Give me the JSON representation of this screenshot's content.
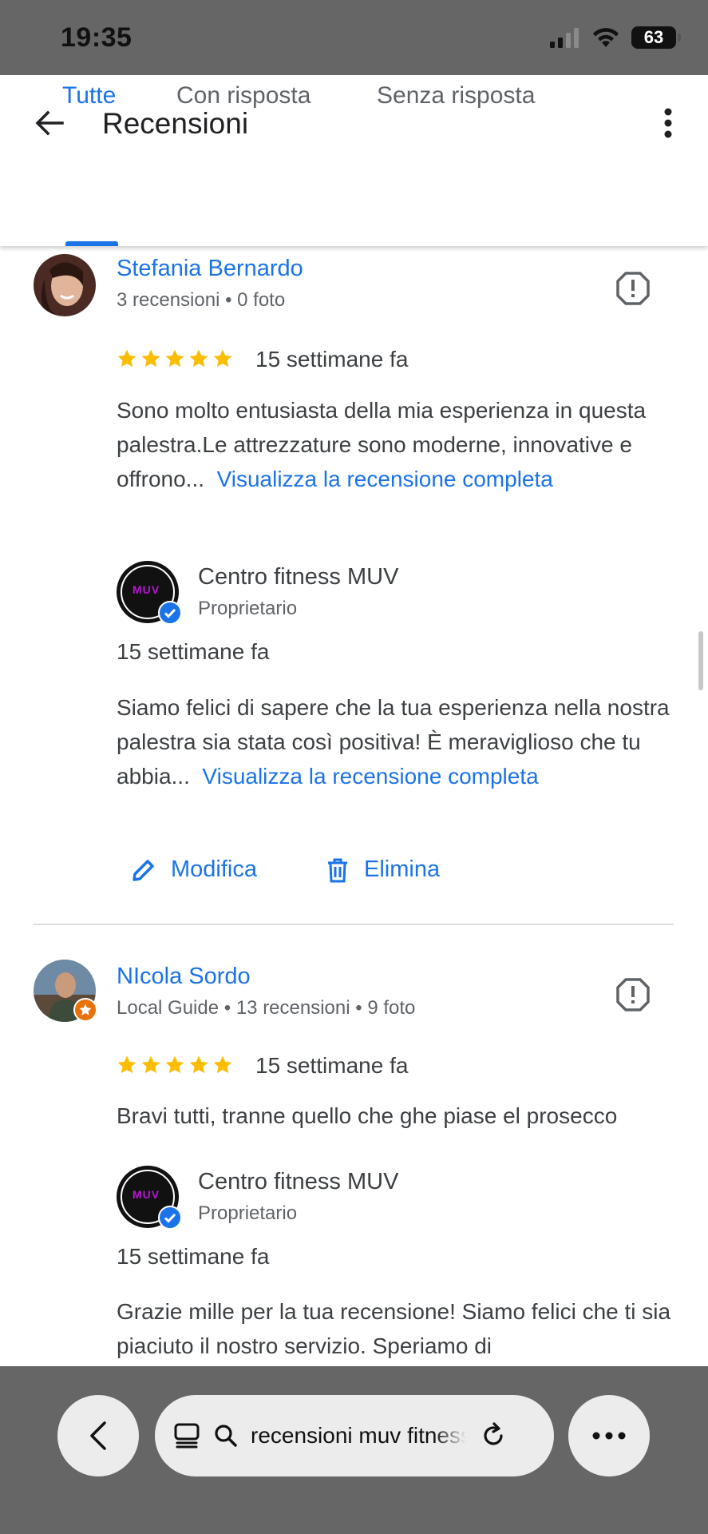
{
  "status_bar": {
    "time": "19:35",
    "battery": "63"
  },
  "header": {
    "title": "Recensioni"
  },
  "tabs": [
    {
      "label": "Tutte",
      "active": true
    },
    {
      "label": "Con risposta",
      "active": false
    },
    {
      "label": "Senza risposta",
      "active": false
    }
  ],
  "reviews": [
    {
      "name": "Stefania Bernardo",
      "meta": "3 recensioni • 0 foto",
      "rating": 5,
      "date": "15 settimane fa",
      "text": "Sono molto entusiasta della mia esperienza in questa palestra.Le attrezzature sono moderne, innovative e offrono...",
      "read_more": "Visualizza la recensione completa",
      "reply": {
        "owner_name": "Centro fitness MUV",
        "owner_role": "Proprietario",
        "logo_text": "MUV",
        "date": "15 settimane fa",
        "text": "Siamo felici di sapere che la tua esperienza nella nostra palestra sia stata così positiva! È meraviglioso che tu abbia...",
        "read_more": "Visualizza la recensione completa"
      },
      "actions": {
        "edit": "Modifica",
        "delete": "Elimina"
      }
    },
    {
      "name": "NIcola Sordo",
      "meta": "Local Guide • 13 recensioni • 9 foto",
      "rating": 5,
      "date": "15 settimane fa",
      "text": "Bravi tutti, tranne quello che ghe piase el prosecco",
      "reply": {
        "owner_name": "Centro fitness MUV",
        "owner_role": "Proprietario",
        "logo_text": "MUV",
        "date": "15 settimane fa",
        "text": "Grazie mille per la tua recensione! Siamo felici che ti sia piaciuto il nostro servizio. Speriamo di"
      }
    }
  ],
  "browser": {
    "url_text": "recensioni muv fitness"
  },
  "colors": {
    "accent": "#1a73e8",
    "star": "#fbbc04",
    "chrome": "#666666",
    "local_guide": "#e8710a"
  }
}
